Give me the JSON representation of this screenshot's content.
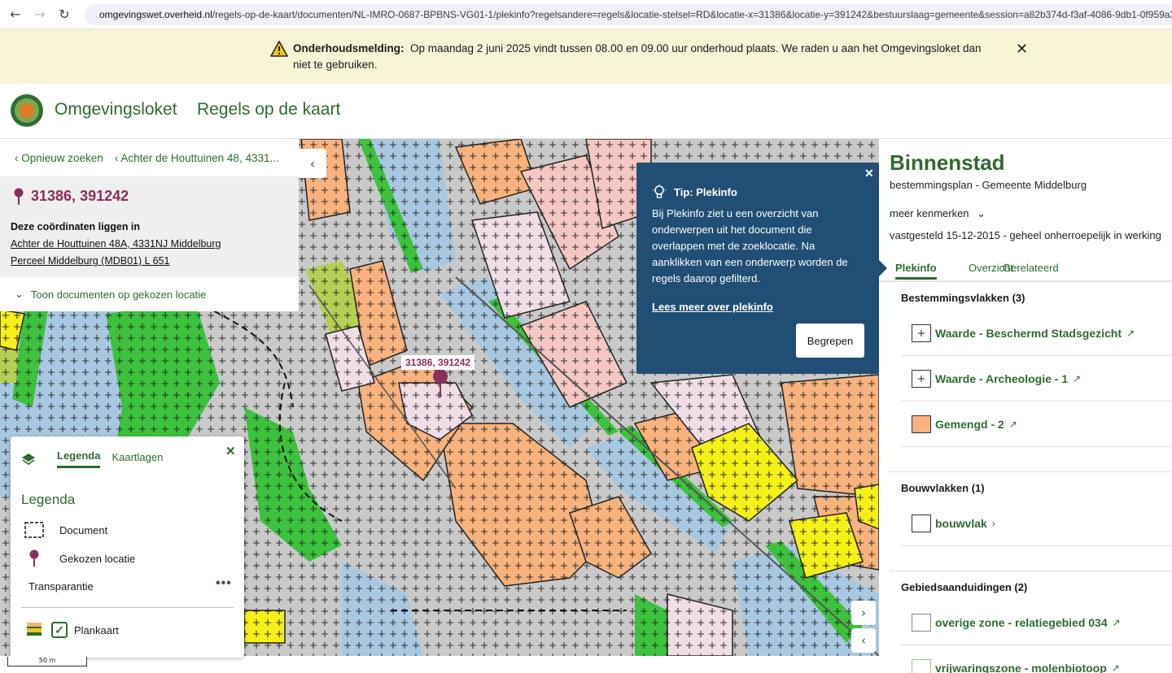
{
  "browser": {
    "url_domain": "omgevingswet.overheid.nl",
    "url_path": "/regels-op-de-kaart/documenten/NL-IMRO-0687-BPBNS-VG01-1/plekinfo?regelsandere=regels&locatie-stelsel=RD&locatie-x=31386&locatie-y=391242&bestuurslaag=gemeente&session=a82b374d-f3af-4086-9db1-0f959a3a5"
  },
  "banner": {
    "label": "Onderhoudsmelding:",
    "text": "Op maandag 2 juni 2025 vindt tussen 08.00 en 09.00 uur onderhoud plaats. We raden u aan het Omgevingsloket dan niet te gebruiken.",
    "close": "✕"
  },
  "header": {
    "brand": "Omgevingsloket",
    "section": "Regels op de kaart"
  },
  "left_panel": {
    "nav_new_search": "Opnieuw zoeken",
    "nav_address": "Achter de Houttuinen 48, 4331...",
    "coords": "31386, 391242",
    "lead": "Deze coördinaten liggen in",
    "address_link": "Achter de Houttuinen 48A, 4331NJ Middelburg",
    "parcel_link": "Perceel Middelburg (MDB01) L 651",
    "show_docs": "Toon documenten op gekozen locatie"
  },
  "map": {
    "marker_label": "31386, 391242"
  },
  "legend": {
    "tab_legend": "Legenda",
    "tab_layers": "Kaartlagen",
    "title": "Legenda",
    "item_document": "Document",
    "item_location": "Gekozen locatie",
    "transparency": "Transparantie",
    "plankaart": "Plankaart",
    "scale": "50 m"
  },
  "tip": {
    "title": "Tip: Plekinfo",
    "body": "Bij Plekinfo ziet u een overzicht van onderwerpen uit het document die overlappen met de zoeklocatie. Na aanklikken van een onderwerp worden de regels daarop gefilterd.",
    "link": "Lees meer over plekinfo",
    "button": "Begrepen"
  },
  "right_panel": {
    "title": "Binnenstad",
    "subtitle": "bestemmingsplan - Gemeente Middelburg",
    "more": "meer kenmerken",
    "status": "vastgesteld 15-12-2015 - geheel onherroepelijk in werking",
    "tabs": [
      "Plekinfo",
      "Overzicht",
      "Gerelateerd"
    ],
    "bestemmingsvlakken": {
      "heading": "Bestemmingsvlakken (3)",
      "items": [
        "Waarde - Beschermd Stadsgezicht",
        "Waarde - Archeologie - 1",
        "Gemengd - 2"
      ]
    },
    "bouwvlakken": {
      "heading": "Bouwvlakken (1)",
      "items": [
        "bouwvlak"
      ]
    },
    "gebiedsaanduidingen": {
      "heading": "Gebiedsaanduidingen (2)",
      "items": [
        "overige zone - relatiegebied 034",
        "vrijwaringszone - molenbiotoop"
      ]
    }
  },
  "colors": {
    "brand_green": "#2e6b30",
    "tip_blue": "#214e74",
    "marker_purple": "#8b2e5e",
    "banner_bg": "#f7f5d6",
    "gemengd_orange": "#f8b27d"
  }
}
